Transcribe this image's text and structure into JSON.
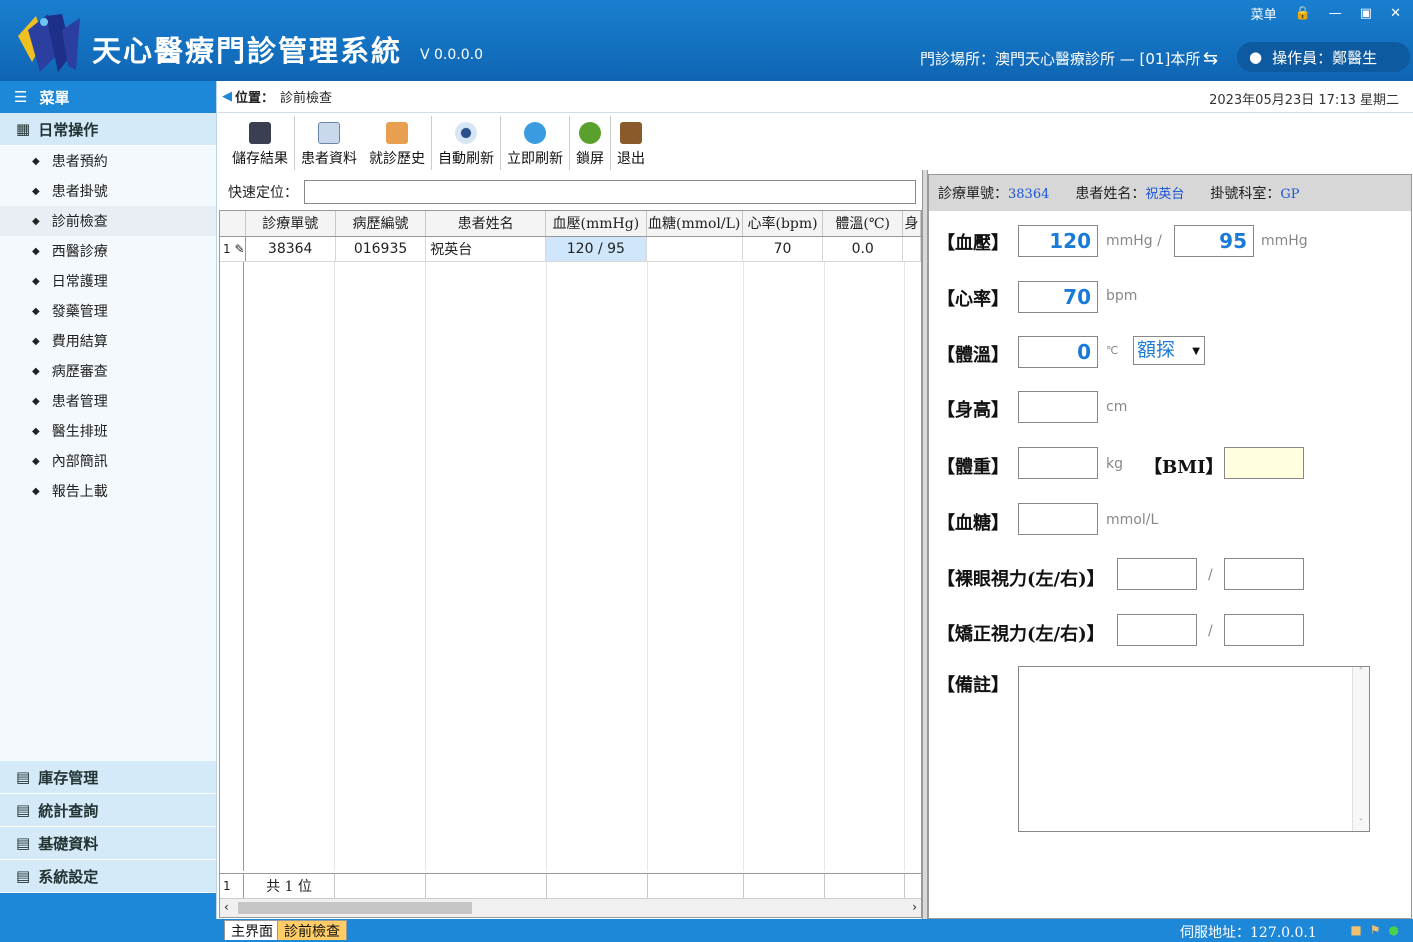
{
  "header": {
    "title": "天心醫療門診管理系統",
    "version": "V 0.0.0.0",
    "win_menu": "菜单",
    "clinic": "門診場所：澳門天心醫療診所 — [01]本所",
    "operator": "操作員：鄭醫生"
  },
  "sidebar": {
    "menu_title": "菜單",
    "daily": "日常操作",
    "items": [
      {
        "label": "患者預約"
      },
      {
        "label": "患者掛號"
      },
      {
        "label": "診前檢查"
      },
      {
        "label": "西醫診療"
      },
      {
        "label": "日常護理"
      },
      {
        "label": "發藥管理"
      },
      {
        "label": "費用結算"
      },
      {
        "label": "病歷審查"
      },
      {
        "label": "患者管理"
      },
      {
        "label": "醫生排班"
      },
      {
        "label": "內部簡訊"
      },
      {
        "label": "報告上載"
      }
    ],
    "groups": [
      {
        "label": "庫存管理"
      },
      {
        "label": "統計查詢"
      },
      {
        "label": "基礎資料"
      },
      {
        "label": "系統設定"
      }
    ]
  },
  "breadcrumb": {
    "label": "位置：",
    "value": "診前檢查",
    "datetime": "2023年05月23日 17:13 星期二"
  },
  "toolbar": {
    "save": "儲存結果",
    "patient": "患者資料",
    "history": "就診歷史",
    "auto": "自動刷新",
    "refresh": "立即刷新",
    "lock": "鎖屏",
    "exit": "退出"
  },
  "quick": {
    "label": "快速定位："
  },
  "grid": {
    "columns": [
      "診療單號",
      "病歷編號",
      "患者姓名",
      "血壓(mmHg)",
      "血糖(mmol/L)",
      "心率(bpm)",
      "體溫(℃)",
      "身"
    ],
    "rows": [
      {
        "rownum": "1",
        "order": "38364",
        "record": "016935",
        "name": "祝英台",
        "bp": "120 / 95",
        "sugar": "",
        "hr": "70",
        "temp": "0.0"
      }
    ],
    "footer_num": "1",
    "footer_total": "共 1 位"
  },
  "panel": {
    "order_label": "診療單號：",
    "order_value": "38364",
    "name_label": "患者姓名：",
    "name_value": "祝英台",
    "dept_label": "掛號科室：",
    "dept_value": "GP",
    "bp_label": "【血壓】",
    "bp_sys": "120",
    "bp_unit1": "mmHg /",
    "bp_dia": "95",
    "bp_unit2": "mmHg",
    "hr_label": "【心率】",
    "hr_value": "70",
    "hr_unit": "bpm",
    "temp_label": "【體溫】",
    "temp_value": "0",
    "temp_unit": "℃",
    "temp_method": "額探",
    "height_label": "【身高】",
    "height_unit": "cm",
    "weight_label": "【體重】",
    "weight_unit": "kg",
    "bmi_label": "【BMI】",
    "sugar_label": "【血糖】",
    "sugar_unit": "mmol/L",
    "naked_label": "【裸眼視力(左/右)】",
    "corrected_label": "【矯正視力(左/右)】",
    "slash": "/",
    "notes_label": "【備註】"
  },
  "status": {
    "tab_main": "主界面",
    "tab_current": "診前檢查",
    "server": "伺服地址：127.0.0.1"
  },
  "colors": {
    "header": "#1370bf",
    "accent": "#1e88d8",
    "value_blue": "#1a7ad8"
  }
}
